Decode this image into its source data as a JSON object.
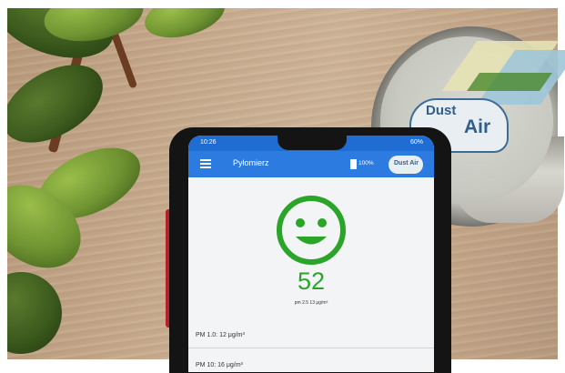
{
  "status_bar": {
    "time": "10:26",
    "right_indicators": "60%"
  },
  "app_bar": {
    "title": "Pyłomierz",
    "battery_label": "100%",
    "logo_text": "Dust Air"
  },
  "reading": {
    "face": "smiley-happy",
    "value": "52",
    "caption": "pm 2.5 13 μg/m³",
    "color": "#2aa52a"
  },
  "measurements": [
    {
      "label": "PM 1.0: 12 μg/m³"
    },
    {
      "label": "PM 10: 16 μg/m³"
    }
  ],
  "sensor_device": {
    "logo_line1": "Dust",
    "logo_line2": "Air"
  },
  "colors": {
    "status_bar": "#1f6dd3",
    "app_bar": "#2b7be0",
    "phone_case": "#b3222a"
  }
}
